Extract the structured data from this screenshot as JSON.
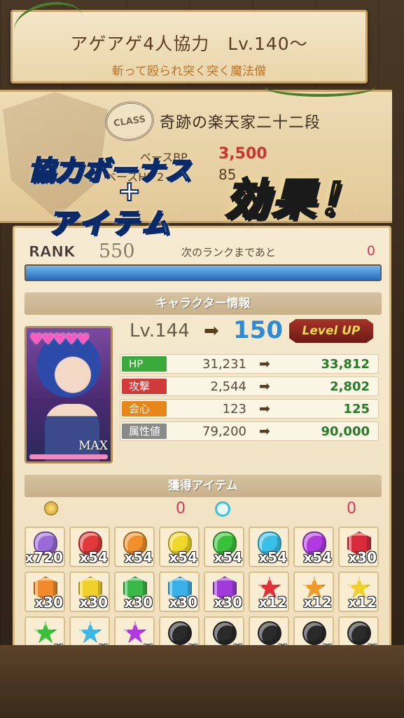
{
  "banner": {
    "title": "アゲアゲ4人協力　Lv.140～",
    "subtitle": "斬って殴られ突く突く魔法僧"
  },
  "class_panel": {
    "stamp": "CLASS",
    "class_name": "奇跡の楽天家二十二段",
    "bp_label": "ベースBP",
    "bp_value": "3,500",
    "hp_label": "ベースHP 2",
    "hp_value": "85"
  },
  "caption": {
    "line1": "協力ボーナス",
    "plus": "+",
    "line2": "アイテム",
    "effect": "効果！"
  },
  "rank": {
    "label": "RANK",
    "value": "550",
    "next_text": "次のランクまであと",
    "remaining": "0",
    "progress_fraction": 1.0
  },
  "character_info": {
    "header": "キャラクター情報",
    "hearts": "♥♥♥♥♥",
    "max_label": "MAX",
    "level_old": "Lv.144",
    "level_arrow": "➡",
    "level_new": "150",
    "level_up_badge": "Level UP",
    "stats": [
      {
        "tag": "HP",
        "color": "#3aa83a",
        "old": "31,231",
        "arrow": "➡",
        "new": "33,812"
      },
      {
        "tag": "攻撃",
        "color": "#d23a3a",
        "old": "2,544",
        "arrow": "➡",
        "new": "2,802"
      },
      {
        "tag": "会心",
        "color": "#e8861a",
        "old": "123",
        "arrow": "➡",
        "new": "125"
      },
      {
        "tag": "属性値",
        "color": "#8a8a8a",
        "old": "79,200",
        "arrow": "➡",
        "new": "90,000"
      }
    ]
  },
  "items": {
    "header": "獲得アイテム",
    "coin_icon": "coin-icon",
    "coin_value": "0",
    "orb_icon": "orb-icon",
    "orb_value": "0",
    "grid": [
      {
        "icon": "vp-gem-icon",
        "shape": "round",
        "color": "#9a6ad8",
        "qty": "x720"
      },
      {
        "icon": "red-egg-icon",
        "shape": "round",
        "color": "#e23a3a",
        "qty": "x54"
      },
      {
        "icon": "orange-egg-icon",
        "shape": "round",
        "color": "#f0902a",
        "qty": "x54"
      },
      {
        "icon": "yellow-egg-icon",
        "shape": "round",
        "color": "#f0d82a",
        "qty": "x54"
      },
      {
        "icon": "green-egg-icon",
        "shape": "round",
        "color": "#3ac03a",
        "qty": "x54"
      },
      {
        "icon": "cyan-egg-icon",
        "shape": "round",
        "color": "#3ac0e8",
        "qty": "x54"
      },
      {
        "icon": "purple-egg-icon",
        "shape": "round",
        "color": "#b03ae0",
        "qty": "x54"
      },
      {
        "icon": "red-hex-gem-icon",
        "shape": "hex",
        "color": "#d82a3a",
        "qty": "x30"
      },
      {
        "icon": "orange-hex-gem-icon",
        "shape": "hex",
        "color": "#f08a2a",
        "qty": "x30"
      },
      {
        "icon": "yellow-hex-gem-icon",
        "shape": "hex",
        "color": "#f0d02a",
        "qty": "x30"
      },
      {
        "icon": "green-hex-gem-icon",
        "shape": "hex",
        "color": "#3ab84a",
        "qty": "x30"
      },
      {
        "icon": "cyan-hex-gem-icon",
        "shape": "hex",
        "color": "#3ab0e8",
        "qty": "x30"
      },
      {
        "icon": "purple-hex-gem-icon",
        "shape": "hex",
        "color": "#a03ad8",
        "qty": "x30"
      },
      {
        "icon": "red-star-gem-icon",
        "shape": "star",
        "color": "#e0303a",
        "qty": "x12"
      },
      {
        "icon": "orange-star-gem-icon",
        "shape": "star",
        "color": "#f09a2a",
        "qty": "x12"
      },
      {
        "icon": "yellow-star-gem-icon",
        "shape": "star",
        "color": "#f0d02a",
        "qty": "x12"
      },
      {
        "icon": "green-star-gem-icon",
        "shape": "star",
        "color": "#3ac03a",
        "qty": "x"
      },
      {
        "icon": "cyan-star-gem-icon",
        "shape": "star",
        "color": "#3ab8e8",
        "qty": "x"
      },
      {
        "icon": "purple-star-gem-icon",
        "shape": "star",
        "color": "#b03ae0",
        "qty": "x"
      },
      {
        "icon": "dark-orb-red-icon",
        "shape": "dark",
        "color": "#2a2a2a",
        "qty": "x"
      },
      {
        "icon": "dark-orb-pink-icon",
        "shape": "dark",
        "color": "#2a2a2a",
        "qty": "x"
      },
      {
        "icon": "dark-orb-cyan-icon",
        "shape": "dark",
        "color": "#2a2a2a",
        "qty": "x"
      },
      {
        "icon": "dark-orb-green-icon",
        "shape": "dark",
        "color": "#2a2a2a",
        "qty": "x"
      },
      {
        "icon": "dark-orb-purple-icon",
        "shape": "dark",
        "color": "#2a2a2a",
        "qty": "x"
      }
    ]
  }
}
